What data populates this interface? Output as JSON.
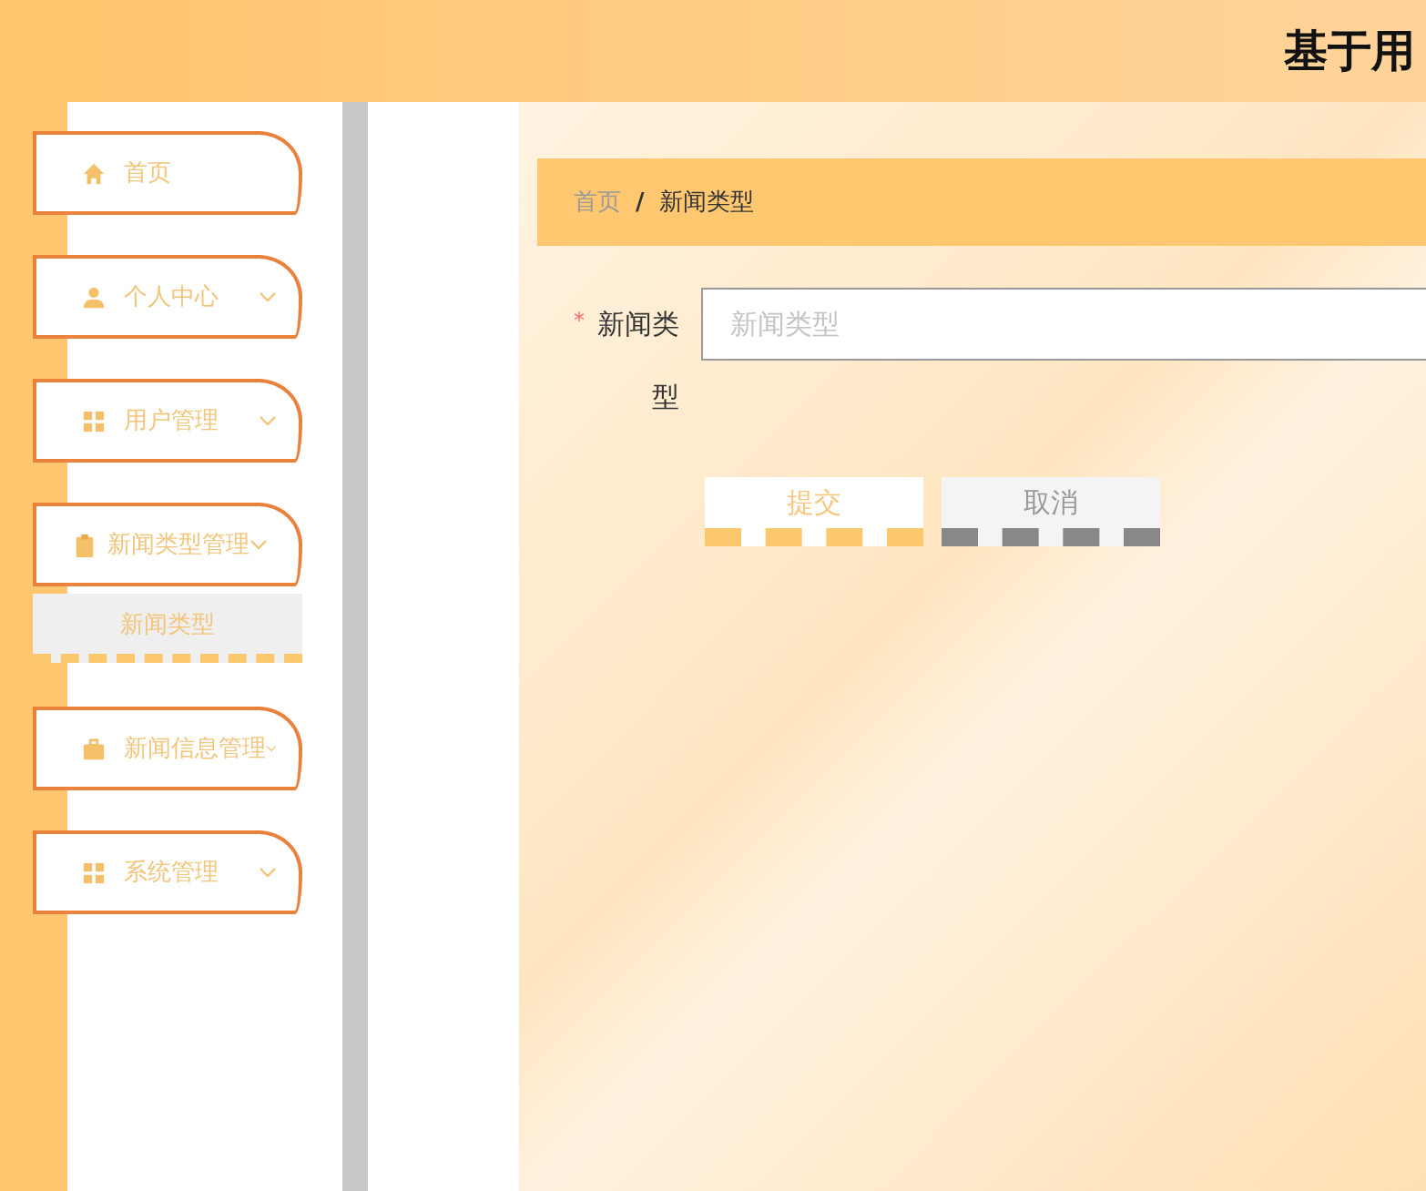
{
  "header": {
    "title": "基于用"
  },
  "menu": [
    {
      "label": "首页",
      "expandable": false
    },
    {
      "label": "个人中心",
      "expandable": true
    },
    {
      "label": "用户管理",
      "expandable": true
    },
    {
      "label": "新闻类型管理",
      "expandable": true,
      "children": [
        {
          "label": "新闻类型",
          "selected": true
        }
      ]
    },
    {
      "label": "新闻信息管理",
      "expandable": true
    },
    {
      "label": "系统管理",
      "expandable": true
    }
  ],
  "breadcrumb": [
    "首页",
    "/",
    "新闻类型"
  ],
  "form": {
    "fields": [
      {
        "label": "新闻类型",
        "required_mark": "*",
        "placeholder": "新闻类型"
      }
    ],
    "buttons": [
      {
        "label": "提交",
        "kind": "primary"
      },
      {
        "label": "取消",
        "kind": "secondary"
      }
    ]
  }
}
